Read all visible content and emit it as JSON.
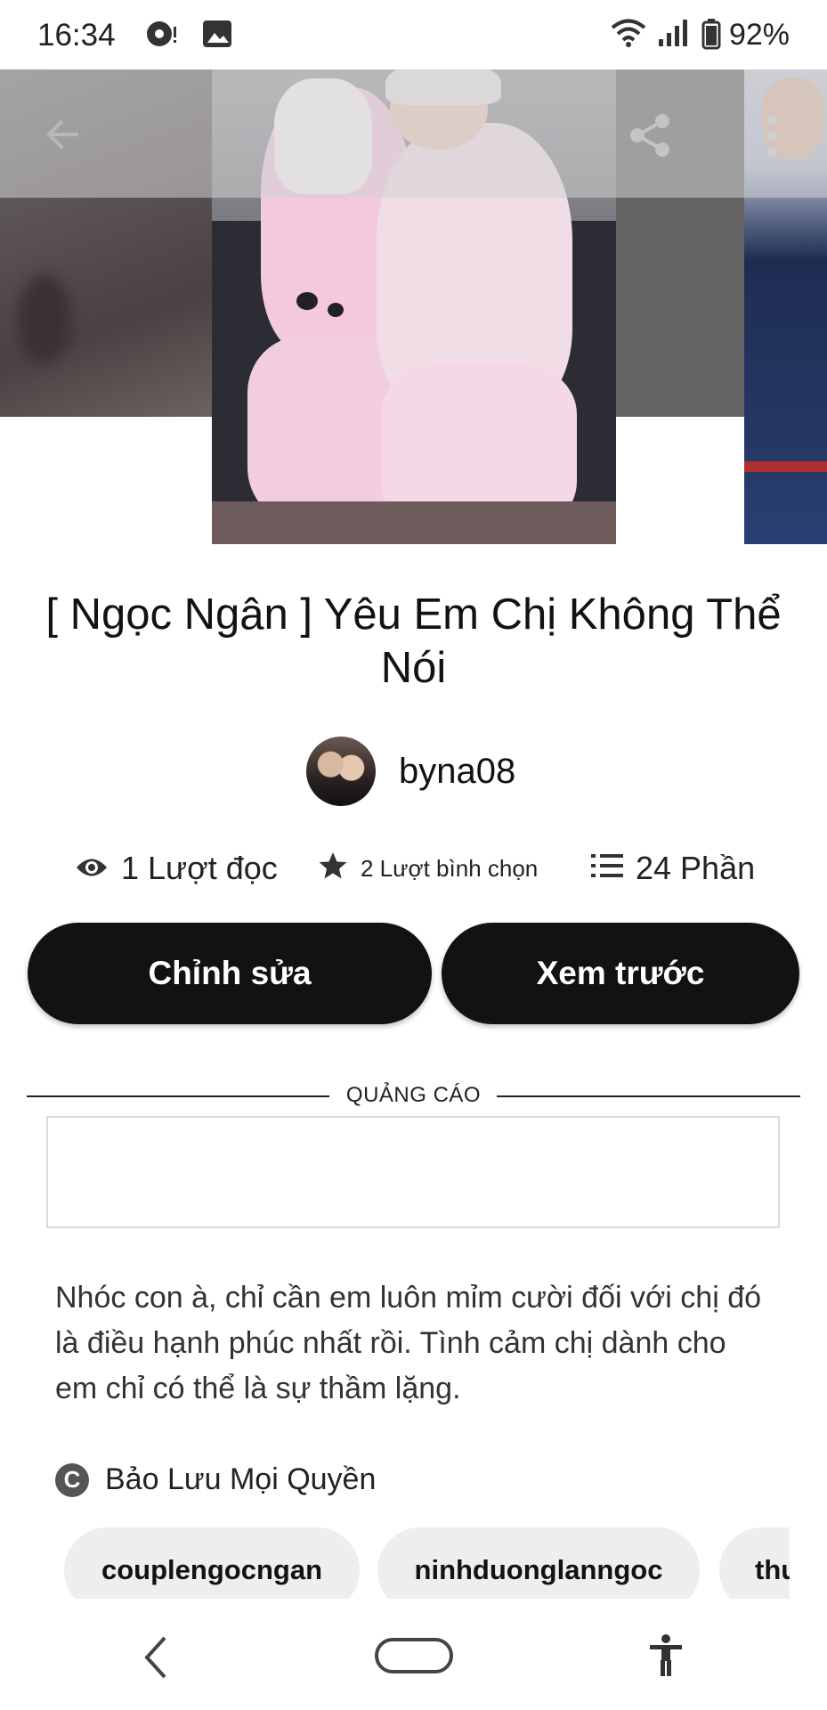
{
  "status_bar": {
    "time": "16:34",
    "battery": "92%"
  },
  "story": {
    "title": "[ Ngọc Ngân ] Yêu Em Chị Không Thể Nói",
    "author": "byna08",
    "reads": "1 Lượt đọc",
    "votes": "2 Lượt bình chọn",
    "parts": "24 Phần",
    "description": "Nhóc con à, chỉ cần em luôn mỉm cười đối với chị đó là điều hạnh phúc nhất rồi. Tình cảm chị dành cho em chỉ có thể là sự thầm lặng.",
    "copyright": "Bảo Lưu Mọi Quyền",
    "tags": [
      "couplengocngan",
      "ninhduonglanngoc",
      "thu"
    ]
  },
  "actions": {
    "edit_label": "Chỉnh sửa",
    "preview_label": "Xem trước"
  },
  "ad": {
    "label": "QUẢNG CÁO"
  },
  "icons": {
    "back": "back-arrow-icon",
    "share": "share-icon",
    "more": "more-vert-icon",
    "eye": "eye-icon",
    "star": "star-icon",
    "list": "list-icon",
    "copyright": "copyright-icon",
    "nav_back": "nav-back-icon",
    "nav_home": "nav-home-icon",
    "accessibility": "accessibility-icon"
  }
}
